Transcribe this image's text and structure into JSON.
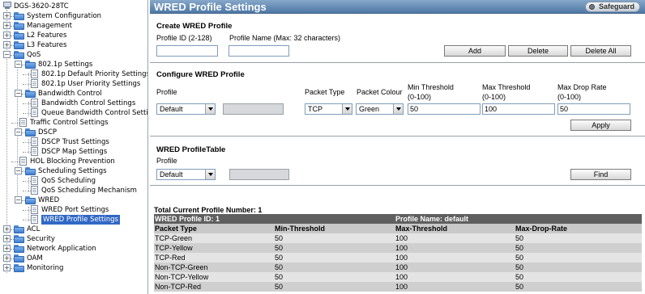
{
  "tree": {
    "root": "DGS-3620-28TC",
    "items": [
      {
        "label": "System Configuration"
      },
      {
        "label": "Management"
      },
      {
        "label": "L2 Features"
      },
      {
        "label": "L3 Features"
      },
      {
        "label": "QoS"
      },
      {
        "label": "802.1p Settings"
      },
      {
        "label": "802.1p Default Priority Settings"
      },
      {
        "label": "802.1p User Priority Settings"
      },
      {
        "label": "Bandwidth Control"
      },
      {
        "label": "Bandwidth Control Settings"
      },
      {
        "label": "Queue Bandwidth Control Settings"
      },
      {
        "label": "Traffic Control Settings"
      },
      {
        "label": "DSCP"
      },
      {
        "label": "DSCP Trust Settings"
      },
      {
        "label": "DSCP Map Settings"
      },
      {
        "label": "HOL Blocking Prevention"
      },
      {
        "label": "Scheduling Settings"
      },
      {
        "label": "QoS Scheduling"
      },
      {
        "label": "QoS Scheduling Mechanism"
      },
      {
        "label": "WRED"
      },
      {
        "label": "WRED Port Settings"
      },
      {
        "label": "WRED Profile Settings"
      },
      {
        "label": "ACL"
      },
      {
        "label": "Security"
      },
      {
        "label": "Network Application"
      },
      {
        "label": "OAM"
      },
      {
        "label": "Monitoring"
      }
    ]
  },
  "page": {
    "title": "WRED Profile Settings",
    "safeguard": "Safeguard"
  },
  "create": {
    "heading": "Create WRED Profile",
    "profile_id_label": "Profile ID (2-128)",
    "profile_id_value": "",
    "profile_name_label": "Profile Name (Max: 32 characters)",
    "profile_name_value": "",
    "add_label": "Add",
    "delete_label": "Delete",
    "delete_all_label": "Delete All"
  },
  "configure": {
    "heading": "Configure WRED Profile",
    "profile_label": "Profile",
    "profile_value": "Default",
    "profile_text_value": "",
    "packet_type_label": "Packet Type",
    "packet_type_value": "TCP",
    "packet_colour_label": "Packet Colour",
    "packet_colour_value": "Green",
    "min_threshold_label": "Min Threshold",
    "min_threshold_range": "(0-100)",
    "min_threshold_value": "50",
    "max_threshold_label": "Max Threshold",
    "max_threshold_range": "(0-100)",
    "max_threshold_value": "100",
    "max_drop_label": "Max Drop Rate",
    "max_drop_range": "(0-100)",
    "max_drop_value": "50",
    "apply_label": "Apply"
  },
  "find": {
    "heading": "WRED ProfileTable",
    "profile_label": "Profile",
    "profile_value": "Default",
    "profile_text_value": "",
    "find_label": "Find"
  },
  "table": {
    "total_label": "Total Current Profile Number: 1",
    "profile_id_header": "WRED Profile ID: 1",
    "profile_name_header": "Profile Name: default",
    "columns": [
      "Packet Type",
      "Min-Threshold",
      "Max-Threshold",
      "Max-Drop-Rate"
    ],
    "rows": [
      [
        "TCP-Green",
        "50",
        "100",
        "50"
      ],
      [
        "TCP-Yellow",
        "50",
        "100",
        "50"
      ],
      [
        "TCP-Red",
        "50",
        "100",
        "50"
      ],
      [
        "Non-TCP-Green",
        "50",
        "100",
        "50"
      ],
      [
        "Non-TCP-Yellow",
        "50",
        "100",
        "50"
      ],
      [
        "Non-TCP-Red",
        "50",
        "100",
        "50"
      ]
    ]
  }
}
